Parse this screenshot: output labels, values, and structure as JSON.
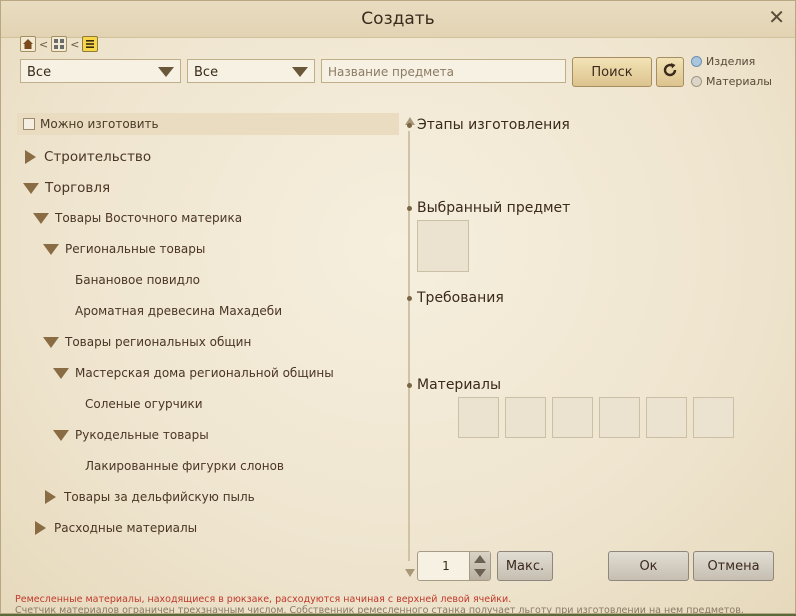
{
  "window": {
    "title": "Создать",
    "close_glyph": "✕"
  },
  "breadcrumb": {
    "separator": "<",
    "icons": [
      "home-icon",
      "grid-icon",
      "list-icon"
    ]
  },
  "filters": {
    "category1": "Все",
    "category2": "Все",
    "search_placeholder": "Название предмета",
    "search_button": "Поиск",
    "radio_products": "Изделия",
    "radio_materials": "Материалы"
  },
  "tree": {
    "can_craft_label": "Можно изготовить",
    "items": [
      {
        "label": "Строительство",
        "state": "collapsed"
      },
      {
        "label": "Торговля",
        "state": "expanded"
      },
      {
        "label": "Товары Восточного материка",
        "state": "expanded"
      },
      {
        "label": "Региональные товары",
        "state": "expanded"
      },
      {
        "label": "Банановое повидло",
        "state": "leaf"
      },
      {
        "label": "Ароматная древесина Махадеби",
        "state": "leaf"
      },
      {
        "label": "Товары региональных общин",
        "state": "expanded"
      },
      {
        "label": "Мастерская дома региональной общины",
        "state": "expanded"
      },
      {
        "label": "Соленые огурчики",
        "state": "leaf"
      },
      {
        "label": "Рукодельные товары",
        "state": "expanded"
      },
      {
        "label": "Лакированные фигурки слонов",
        "state": "leaf"
      },
      {
        "label": "Товары за дельфийскую пыль",
        "state": "collapsed"
      },
      {
        "label": "Расходные материалы",
        "state": "collapsed"
      }
    ]
  },
  "details": {
    "stages": "Этапы изготовления",
    "selected_item": "Выбранный предмет",
    "requirements": "Требования",
    "materials": "Материалы"
  },
  "footer": {
    "quantity": "1",
    "max_button": "Макс.",
    "ok_button": "Ок",
    "cancel_button": "Отмена",
    "note_red": "Ремесленные материалы, находящиеся в рюкзаке, расходуются начиная с верхней левой ячейки.",
    "note_gray": "Счетчик материалов ограничен трехзначным числом. Собственник ремесленного станка получает льготу при изготовлении на нем предметов."
  },
  "colors": {
    "accent_button": "#dcc38e",
    "warning_text": "#c1392b",
    "tree_arrow": "#8a6c44"
  }
}
